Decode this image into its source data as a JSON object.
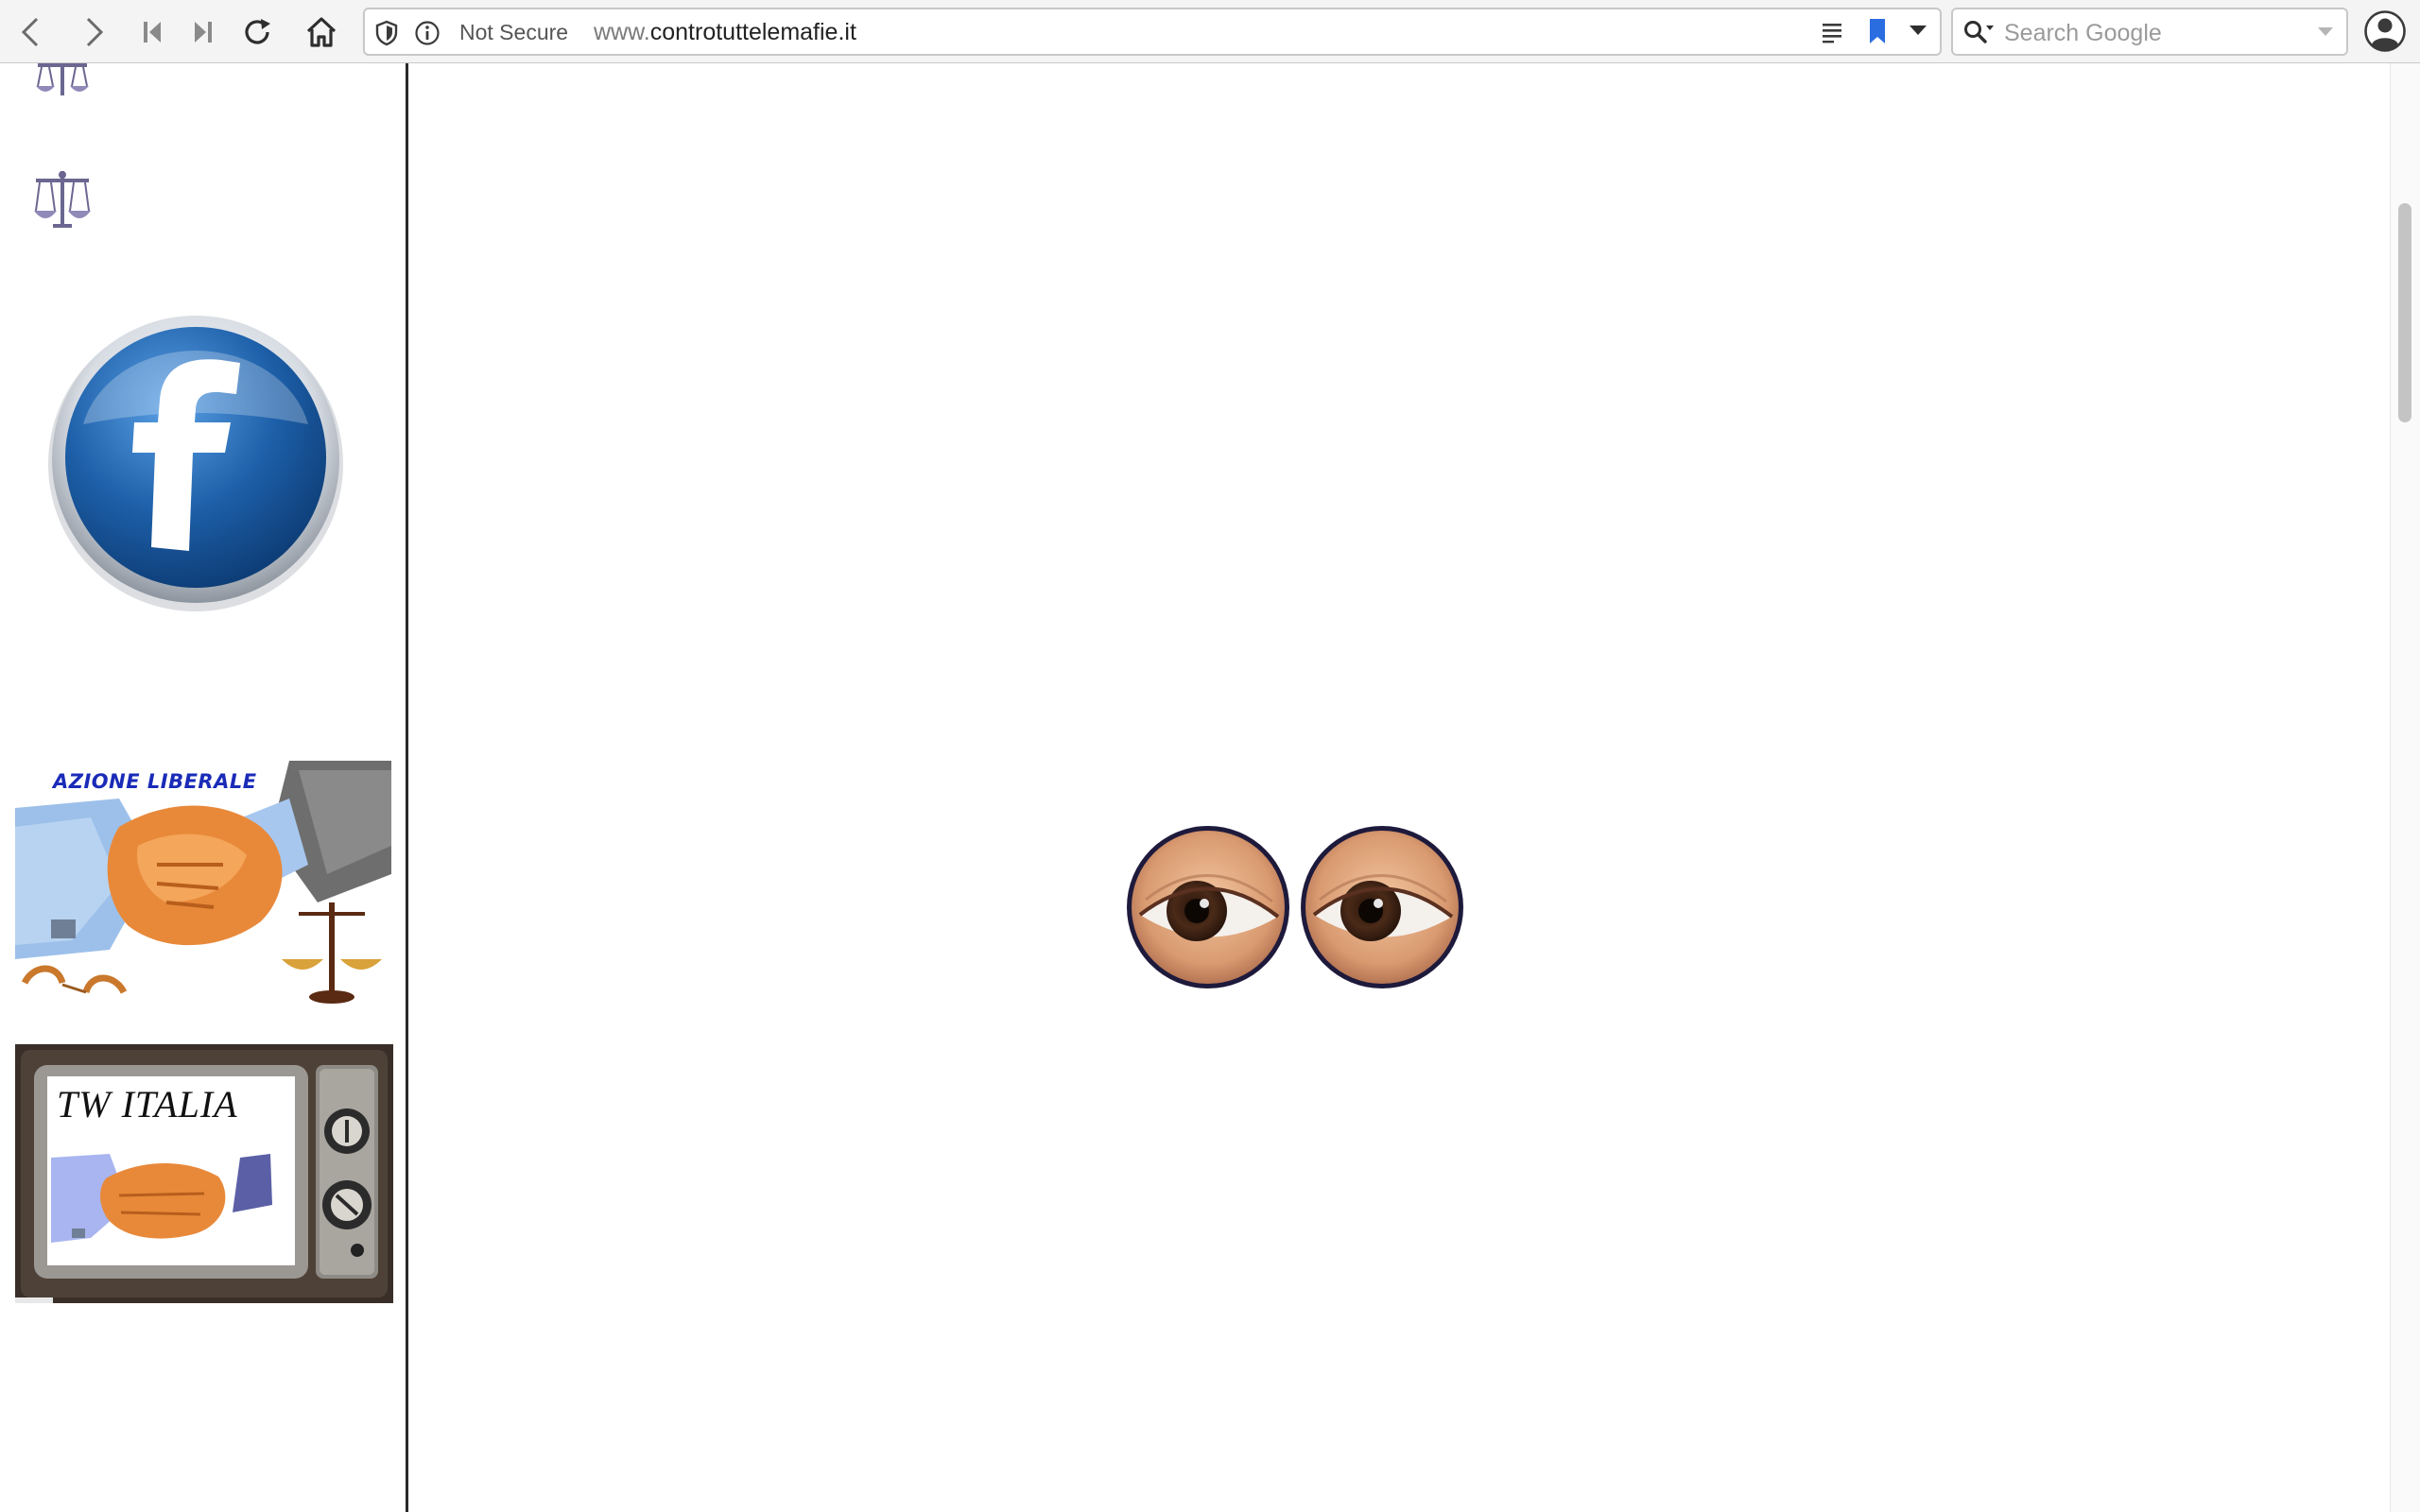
{
  "browser": {
    "back_icon": "chevron-left-icon",
    "forward_icon": "chevron-right-icon",
    "url": {
      "security_label": "Not Secure",
      "prefix": "www.",
      "domain": "controtuttelemafie.it"
    },
    "search": {
      "placeholder": "Search Google"
    }
  },
  "sidebar": {
    "azione_banner_title": "AZIONE LIBERALE",
    "tv_banner_title": "TW ITALIA"
  },
  "colors": {
    "facebook_blue": "#1d5fa8",
    "bookmark_blue": "#2a6de0",
    "azione_title": "#1a2bb8",
    "handshake_orange": "#e8893a"
  }
}
